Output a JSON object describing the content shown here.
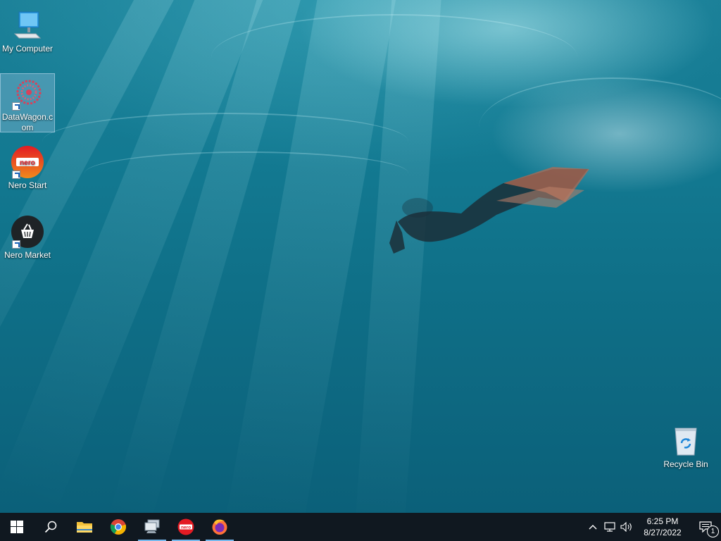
{
  "desktop": {
    "icons": [
      {
        "label": "My Computer",
        "icon": "computer-icon"
      },
      {
        "label": "DataWagon.com",
        "icon": "datawagon-icon",
        "selected": true
      },
      {
        "label": "Nero Start",
        "icon": "nero-start-icon"
      },
      {
        "label": "Nero Market",
        "icon": "nero-market-icon"
      },
      {
        "label": "Recycle Bin",
        "icon": "recycle-bin-icon"
      }
    ]
  },
  "taskbar": {
    "buttons": [
      {
        "name": "start-button",
        "icon": "windows-logo-icon"
      },
      {
        "name": "search-button",
        "icon": "search-icon"
      },
      {
        "name": "file-explorer-button",
        "icon": "folder-icon"
      },
      {
        "name": "chrome-button",
        "icon": "chrome-icon"
      },
      {
        "name": "network-app-button",
        "icon": "computers-icon",
        "running": true
      },
      {
        "name": "nero-button",
        "icon": "nero-icon",
        "running": true
      },
      {
        "name": "firefox-button",
        "icon": "firefox-icon",
        "running": true
      }
    ],
    "tray": {
      "clock_time": "6:25 PM",
      "clock_date": "8/27/2022",
      "notification_count": "1"
    }
  },
  "colors": {
    "taskbar": "#101820",
    "accent": "#76b9ed",
    "water": "#137a92"
  }
}
